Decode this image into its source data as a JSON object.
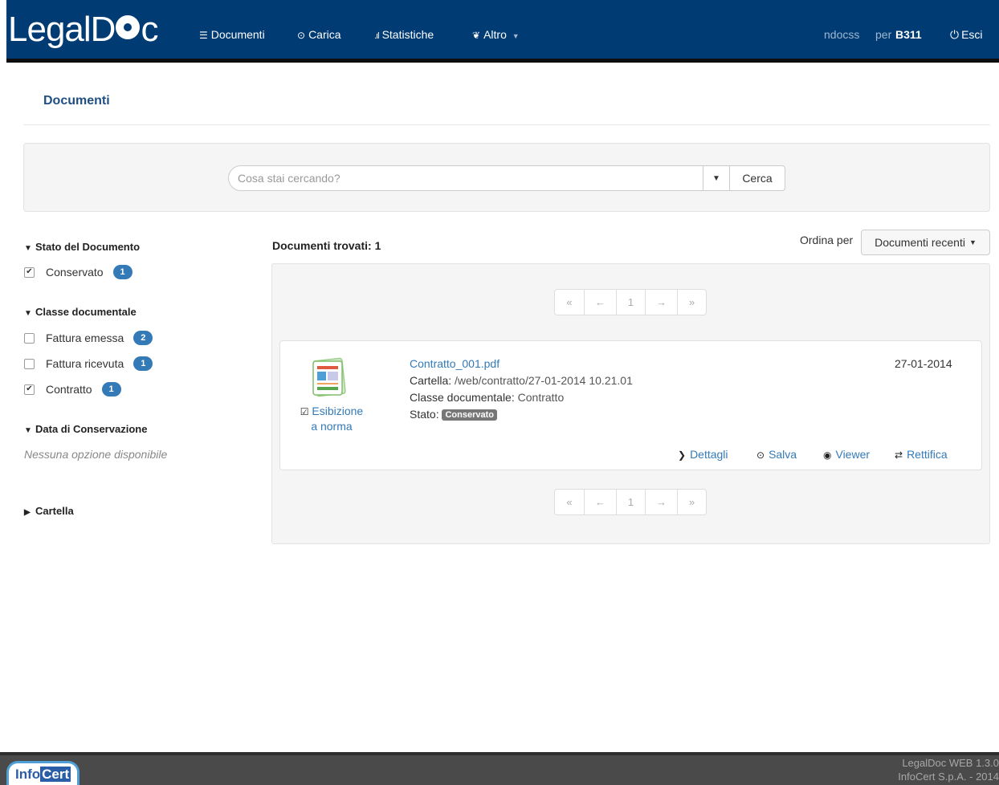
{
  "navbar": {
    "logo_prefix": "LegalD",
    "logo_suffix": "c",
    "items": [
      {
        "label": "Documenti",
        "icon": "list-icon"
      },
      {
        "label": "Carica",
        "icon": "upload-icon"
      },
      {
        "label": "Statistiche",
        "icon": "signal-icon"
      },
      {
        "label": "Altro",
        "icon": "leaf-icon"
      }
    ],
    "user": "ndocss",
    "per_label": "per",
    "org": "B311",
    "logout_label": "Esci"
  },
  "page": {
    "title": "Documenti"
  },
  "search": {
    "placeholder": "Cosa stai cercando?",
    "button_label": "Cerca"
  },
  "sidebar": {
    "stato": {
      "heading": "Stato del Documento",
      "items": [
        {
          "label": "Conservato",
          "count": "1",
          "checked": true
        }
      ]
    },
    "classe": {
      "heading": "Classe documentale",
      "items": [
        {
          "label": "Fattura emessa",
          "count": "2",
          "checked": false
        },
        {
          "label": "Fattura ricevuta",
          "count": "1",
          "checked": false
        },
        {
          "label": "Contratto",
          "count": "1",
          "checked": true
        }
      ]
    },
    "data": {
      "heading": "Data di Conservazione",
      "empty": "Nessuna opzione disponibile"
    },
    "cartella": {
      "heading": "Cartella"
    }
  },
  "results": {
    "count_label": "Documenti trovati: 1",
    "sort_label": "Ordina per",
    "sort_value": "Documenti recenti",
    "pager": {
      "first": "«",
      "prev": "←",
      "page": "1",
      "next": "→",
      "last": "»"
    }
  },
  "document": {
    "name": "Contratto_001.pdf",
    "cartella_label": "Cartella:",
    "cartella_value": "/web/contratto/27-01-2014 10.21.01",
    "classe_label": "Classe documentale:",
    "classe_value": "Contratto",
    "stato_label": "Stato:",
    "stato_value": "Conservato",
    "date": "27-01-2014",
    "esibizione_line1": "Esibizione",
    "esibizione_line2": "a norma",
    "actions": {
      "dettagli": "Dettagli",
      "salva": "Salva",
      "viewer": "Viewer",
      "rettifica": "Rettifica"
    }
  },
  "footer": {
    "logo_a": "Info",
    "logo_b": "Cert",
    "version": "LegalDoc WEB 1.3.0",
    "copyright": "InfoCert S.p.A. - 2014"
  },
  "colors": {
    "navbar_bg": "#003b74",
    "link": "#337ab7",
    "badge": "#337ab7",
    "status_label": "#777777",
    "footer_bg": "#4a4a4a"
  }
}
